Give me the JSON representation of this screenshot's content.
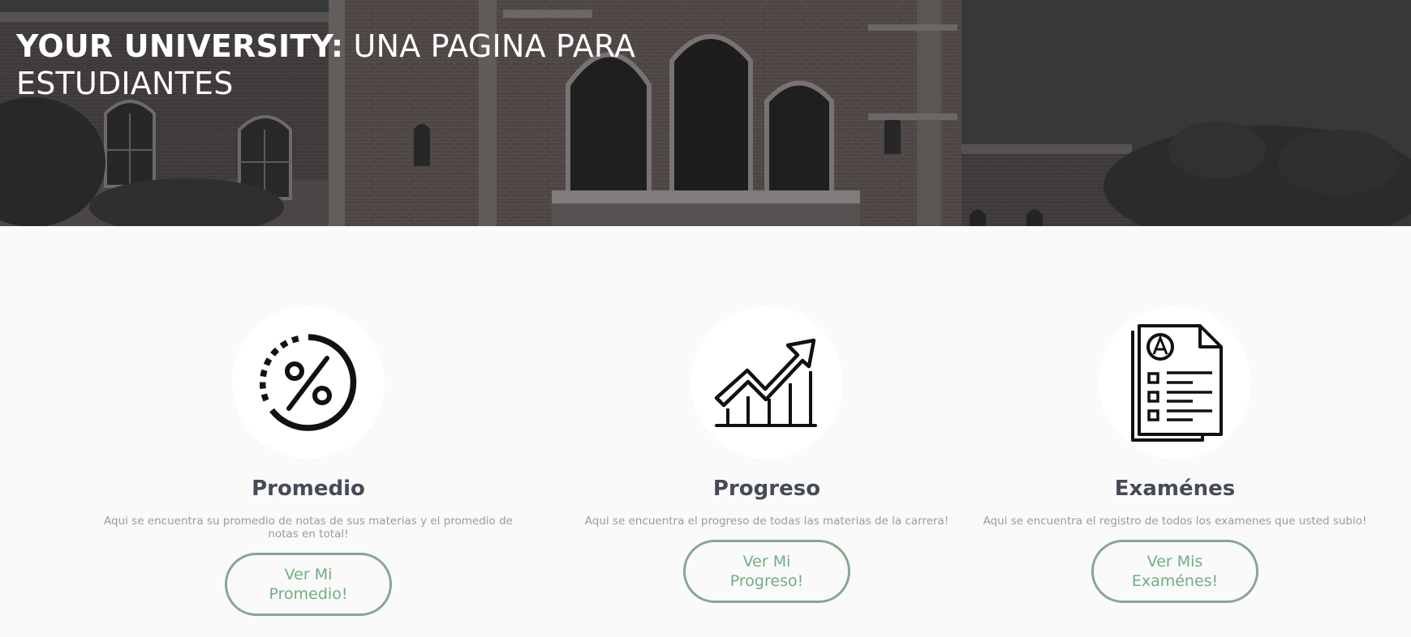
{
  "hero": {
    "title_bold": "YOUR UNIVERSITY:",
    "title_rest": " UNA PAGINA PARA ESTUDIANTES"
  },
  "cards": [
    {
      "icon": "percent-icon",
      "title": "Promedio",
      "description": "Aqui se encuentra su promedio de notas de sus materias y el promedio de notas en total!",
      "button_label": "Ver Mi Promedio!"
    },
    {
      "icon": "growth-chart-icon",
      "title": "Progreso",
      "description": "Aqui se encuentra el progreso de todas las materias de la carrera!",
      "button_label": "Ver Mi Progreso!"
    },
    {
      "icon": "exam-sheet-icon",
      "title": "Examénes",
      "description": "Aqui se encuentra el registro de todos los examenes que usted subio!",
      "button_label": "Ver Mis Examénes!"
    }
  ],
  "colors": {
    "page_background": "#fafafa",
    "heading": "#464a59",
    "description": "#9a9aa1",
    "button_border": "#86a78f",
    "button_text": "#6fae84"
  }
}
